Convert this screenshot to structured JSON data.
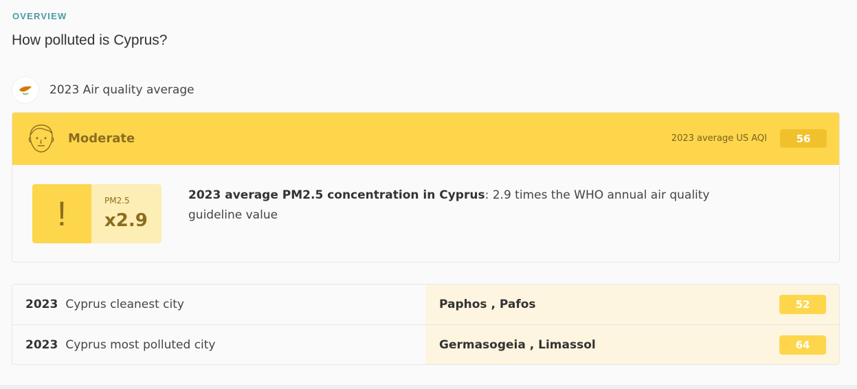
{
  "section_label": "OVERVIEW",
  "title": "How polluted is Cyprus?",
  "average": {
    "label": "2023 Air quality average",
    "flag_icon": "cyprus-flag-icon"
  },
  "aqi": {
    "level": "Moderate",
    "label": "2023 average US AQI",
    "value": "56",
    "color": "#fdd64b"
  },
  "pm25": {
    "pollutant": "PM2.5",
    "times": "x2.9",
    "warning_symbol": "!",
    "description_bold": "2023 average PM2.5 concentration in Cyprus",
    "description_rest": ": 2.9 times the WHO annual air quality guideline value"
  },
  "cities": [
    {
      "year": "2023",
      "label": "Cyprus cleanest city",
      "city": "Paphos , Pafos",
      "aqi": "52"
    },
    {
      "year": "2023",
      "label": "Cyprus most polluted city",
      "city": "Germasogeia , Limassol",
      "aqi": "64"
    }
  ]
}
